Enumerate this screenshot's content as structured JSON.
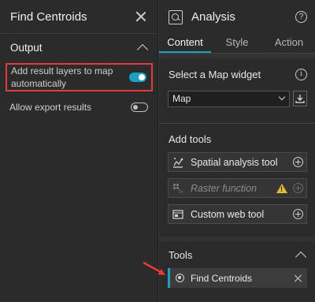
{
  "left_panel": {
    "title": "Find Centroids",
    "section_title": "Output",
    "options": [
      {
        "label": "Add result layers to map automatically",
        "enabled": true
      },
      {
        "label": "Allow export results",
        "enabled": false
      }
    ]
  },
  "right_panel": {
    "title": "Analysis",
    "tabs": [
      {
        "label": "Content",
        "active": true
      },
      {
        "label": "Style",
        "active": false
      },
      {
        "label": "Action",
        "active": false
      }
    ],
    "map_widget": {
      "label": "Select a Map widget",
      "selected": "Map"
    },
    "add_tools_label": "Add tools",
    "tool_buttons": [
      {
        "label": "Spatial analysis tool",
        "icon": "spatial-analysis-icon",
        "disabled": false
      },
      {
        "label": "Raster function",
        "icon": "raster-function-icon",
        "disabled": true,
        "warning": true
      },
      {
        "label": "Custom web tool",
        "icon": "custom-web-tool-icon",
        "disabled": false
      }
    ],
    "tools_section_title": "Tools",
    "tools": [
      {
        "label": "Find Centroids",
        "icon": "find-centroids-icon"
      }
    ]
  },
  "colors": {
    "accent": "#1da1c2",
    "highlight_border": "#e03c3c",
    "background": "#2b2b2b",
    "warning": "#e8b830"
  }
}
